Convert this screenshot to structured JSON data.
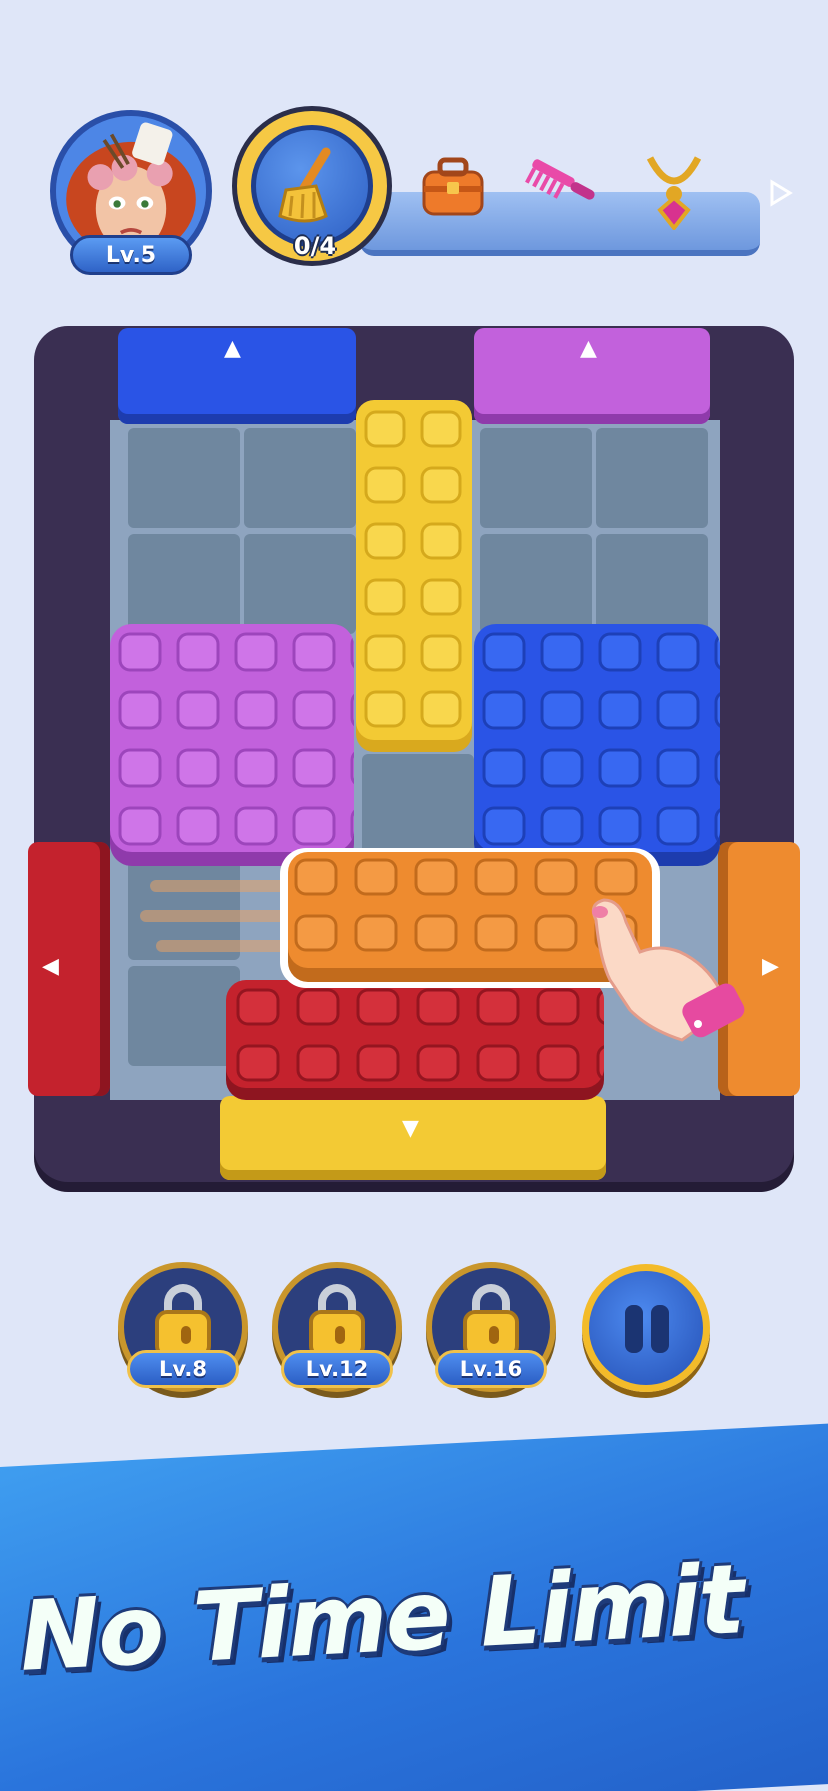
{
  "player": {
    "level_label": "Lv.5"
  },
  "task": {
    "progress_text": "0/4",
    "progress": 0
  },
  "collectibles": [
    {
      "name": "broom-icon"
    },
    {
      "name": "toolbox-icon"
    },
    {
      "name": "comb-icon"
    },
    {
      "name": "necklace-icon"
    }
  ],
  "boosters": [
    {
      "level_label": "Lv.8",
      "locked": true
    },
    {
      "level_label": "Lv.12",
      "locked": true
    },
    {
      "level_label": "Lv.16",
      "locked": true
    }
  ],
  "pause": {
    "icon": "pause-icon"
  },
  "banner": {
    "text": "No Time Limit"
  },
  "colors": {
    "blue": "#2a54e6",
    "purple": "#c261dc",
    "yellow": "#f3ca34",
    "red": "#c4222d",
    "orange": "#ee8b2f",
    "frame": "#3a2f52"
  }
}
